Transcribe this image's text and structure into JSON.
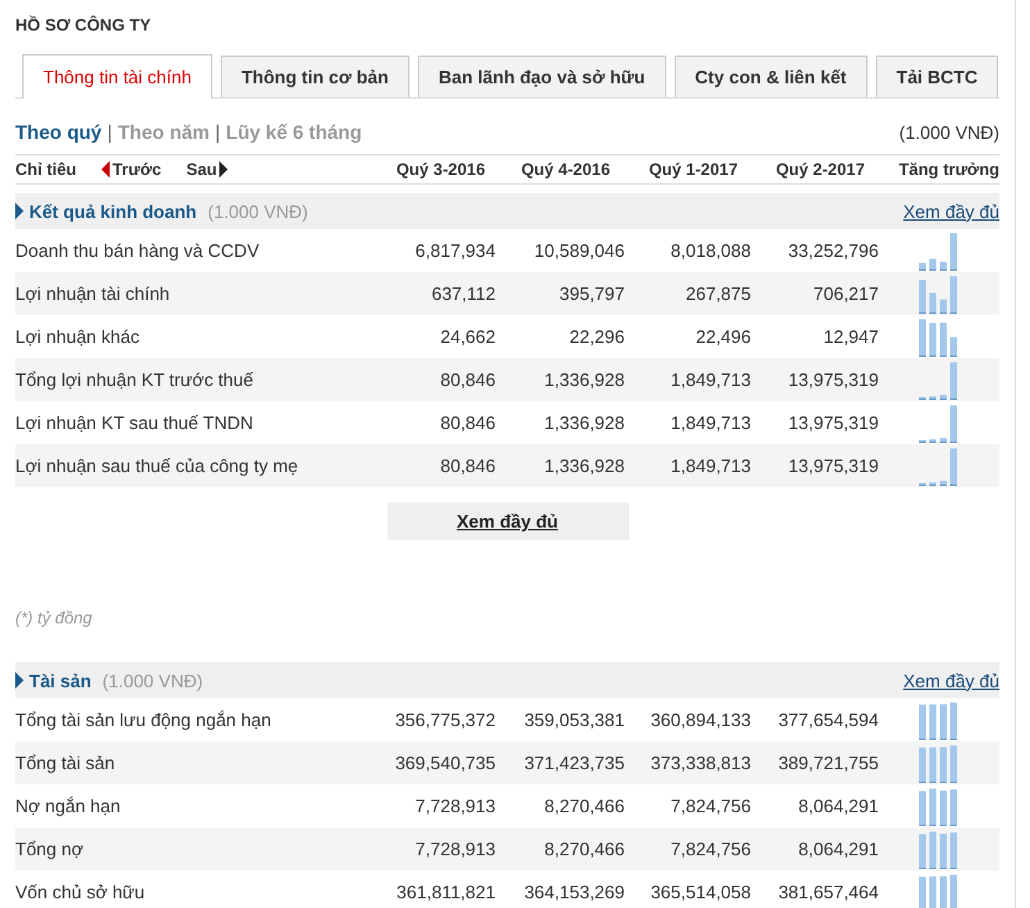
{
  "page_title": "HỒ SƠ CÔNG TY",
  "tabs": [
    {
      "label": "Thông tin tài chính",
      "selected": true
    },
    {
      "label": "Thông tin cơ bản",
      "selected": false
    },
    {
      "label": "Ban lãnh đạo và sở hữu",
      "selected": false
    },
    {
      "label": "Cty con & liên kết",
      "selected": false
    },
    {
      "label": "Tải BCTC",
      "selected": false
    }
  ],
  "periods": [
    {
      "label": "Theo quý",
      "selected": true
    },
    {
      "label": "Theo năm",
      "selected": false
    },
    {
      "label": "Lũy kế 6 tháng",
      "selected": false
    }
  ],
  "period_separator": "|",
  "unit": "(1.000 VNĐ)",
  "columns": {
    "indicator": "Chỉ tiêu",
    "previous": "Trước",
    "next": "Sau",
    "periods": [
      "Quý 3-2016",
      "Quý 4-2016",
      "Quý 1-2017",
      "Quý 2-2017"
    ],
    "growth": "Tăng trưởng"
  },
  "sections": [
    {
      "title": "Kết quả kinh doanh",
      "unit": "(1.000 VNĐ)",
      "link": "Xem đầy đủ",
      "rows": [
        {
          "label": "Doanh thu bán hàng và CCDV",
          "values": [
            "6,817,934",
            "10,589,046",
            "8,018,088",
            "33,252,796"
          ]
        },
        {
          "label": "Lợi nhuận tài chính",
          "values": [
            "637,112",
            "395,797",
            "267,875",
            "706,217"
          ]
        },
        {
          "label": "Lợi nhuận khác",
          "values": [
            "24,662",
            "22,296",
            "22,496",
            "12,947"
          ]
        },
        {
          "label": "Tổng lợi nhuận KT trước thuế",
          "values": [
            "80,846",
            "1,336,928",
            "1,849,713",
            "13,975,319"
          ]
        },
        {
          "label": "Lợi nhuận KT sau thuế TNDN",
          "values": [
            "80,846",
            "1,336,928",
            "1,849,713",
            "13,975,319"
          ]
        },
        {
          "label": "Lợi nhuận sau thuế của công ty mẹ",
          "values": [
            "80,846",
            "1,336,928",
            "1,849,713",
            "13,975,319"
          ]
        }
      ],
      "more_button": "Xem đầy đủ",
      "note": "(*) tỷ đồng"
    },
    {
      "title": "Tài sản",
      "unit": "(1.000 VNĐ)",
      "link": "Xem đầy đủ",
      "rows": [
        {
          "label": "Tổng tài sản lưu động ngắn hạn",
          "values": [
            "356,775,372",
            "359,053,381",
            "360,894,133",
            "377,654,594"
          ]
        },
        {
          "label": "Tổng tài sản",
          "values": [
            "369,540,735",
            "371,423,735",
            "373,338,813",
            "389,721,755"
          ]
        },
        {
          "label": "Nợ ngắn hạn",
          "values": [
            "7,728,913",
            "8,270,466",
            "7,824,756",
            "8,064,291"
          ]
        },
        {
          "label": "Tổng nợ",
          "values": [
            "7,728,913",
            "8,270,466",
            "7,824,756",
            "8,064,291"
          ]
        },
        {
          "label": "Vốn chủ sở hữu",
          "values": [
            "361,811,821",
            "364,153,269",
            "365,514,058",
            "381,657,464"
          ]
        }
      ]
    }
  ]
}
